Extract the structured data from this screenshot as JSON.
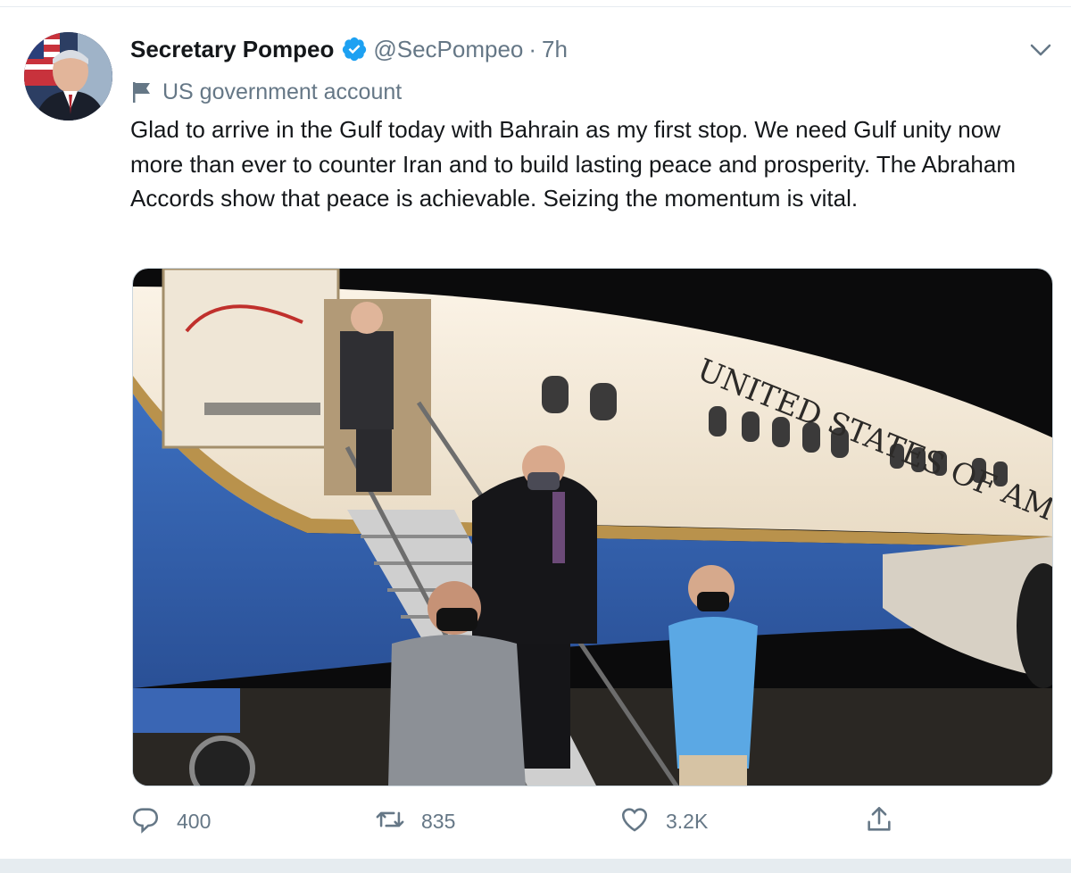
{
  "tweet": {
    "display_name": "Secretary Pompeo",
    "handle": "@SecPompeo",
    "separator": "·",
    "time": "7h",
    "account_label": "US government account",
    "text": "Glad to arrive in the Gulf today with Bahrain as my first stop. We need Gulf unity now more than ever to counter Iran and to build lasting peace and prosperity. The Abraham Accords show that peace is achievable. Seizing the momentum is vital.",
    "media_caption_on_plane": "UNITED STATES OF AM"
  },
  "actions": {
    "reply_count": "400",
    "retweet_count": "835",
    "like_count": "3.2K"
  },
  "icons": {
    "verified": "verified-badge-icon",
    "label": "flag-icon",
    "menu": "chevron-down-icon",
    "reply": "reply-icon",
    "retweet": "retweet-icon",
    "like": "heart-icon",
    "share": "share-icon"
  },
  "colors": {
    "brand_blue": "#1da1f2",
    "secondary_text": "#657786",
    "primary_text": "#14171a"
  }
}
